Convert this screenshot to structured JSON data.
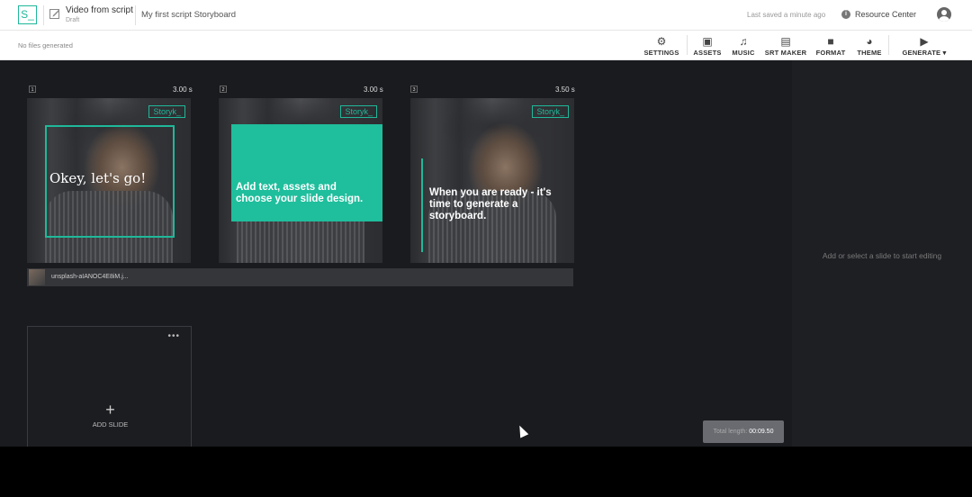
{
  "header": {
    "logo_text": "S_",
    "project_title": "Video from script",
    "project_status": "Draft",
    "storyboard_name": "My first script Storyboard",
    "last_saved": "Last saved a minute ago",
    "resource_center": "Resource Center",
    "info_icon": "i"
  },
  "toolbar": {
    "status": "No files generated",
    "tools": {
      "settings": {
        "label": "SETTINGS",
        "icon": "⚙"
      },
      "assets": {
        "label": "ASSETS",
        "icon": "▣"
      },
      "music": {
        "label": "MUSIC",
        "icon": "♫"
      },
      "srt": {
        "label": "SRT MAKER",
        "icon": "▤"
      },
      "format": {
        "label": "FORMAT",
        "icon": "■"
      },
      "theme": {
        "label": "THEME",
        "icon": "◕"
      },
      "generate": {
        "label": "GENERATE ▾",
        "icon": "▶"
      }
    }
  },
  "slides": [
    {
      "number": "1",
      "duration": "3.00 s",
      "text": "Okey, let's go!",
      "brand": "Storyk_"
    },
    {
      "number": "2",
      "duration": "3.00 s",
      "text": "Add text, assets and choose your slide design.",
      "brand": "Storyk_"
    },
    {
      "number": "3",
      "duration": "3.50 s",
      "text": "When you are ready - it's time to generate a storyboard.",
      "brand": "Storyk_"
    }
  ],
  "audio": {
    "filename": "unsplash-aIANOC4E8iM.j..."
  },
  "add_slide": {
    "label": "ADD SLIDE",
    "plus": "+",
    "menu": "•••"
  },
  "total_length": {
    "label": "Total length:",
    "value": "00:09.50"
  },
  "right_panel": {
    "hint": "Add or select a slide to start editing"
  },
  "colors": {
    "accent": "#1fb89a",
    "canvas": "#1a1b1f",
    "panel": "#1e1f23"
  }
}
